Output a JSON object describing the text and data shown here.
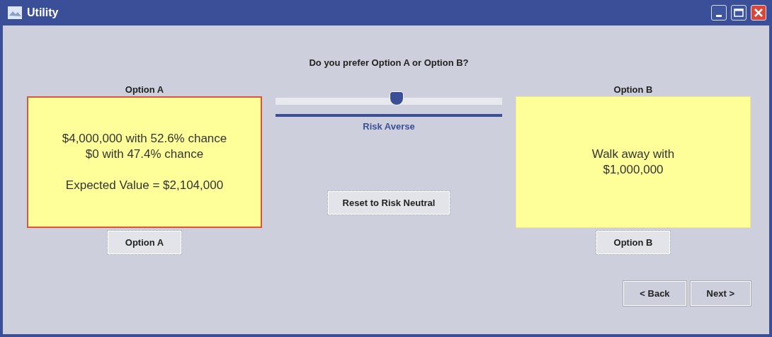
{
  "window": {
    "title": "Utility"
  },
  "question": "Do you prefer Option A or Option B?",
  "options": [
    {
      "heading": "Option A",
      "lines": [
        "$4,000,000 with 52.6% chance",
        "$0 with 47.4% chance"
      ],
      "expected_value": "Expected Value = $2,104,000",
      "highlighted": true,
      "button": "Option A"
    },
    {
      "heading": "Option B",
      "lines": [
        "Walk away with",
        "$1,000,000"
      ],
      "highlighted": false,
      "button": "Option B"
    }
  ],
  "slider": {
    "level": 0.53,
    "reading": "Risk Averse"
  },
  "reset_button": "Reset to Risk Neutral",
  "buttons": [
    "< Back",
    "Next >"
  ]
}
